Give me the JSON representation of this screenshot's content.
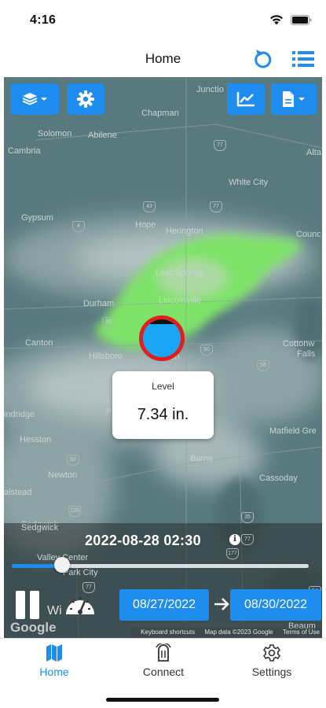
{
  "status_bar": {
    "time": "4:16"
  },
  "nav": {
    "title": "Home",
    "refresh_icon": "refresh-icon",
    "list_icon": "list-icon"
  },
  "map": {
    "places": {
      "junction": "Junctio",
      "chapman": "Chapman",
      "solomon": "Solomon",
      "abilene": "Abilene",
      "cambria": "Cambria",
      "alta": "Alta",
      "white_city": "White City",
      "gypsum": "Gypsum",
      "hope": "Hope",
      "herington": "Herington",
      "counc": "Counc",
      "lost_springs": "Lost Springs",
      "durham": "Durham",
      "lincolnville": "Lincolnville",
      "canton": "Canton",
      "hillsboro": "Hillsboro",
      "marion": "Marion",
      "cottonw": "Cottonw",
      "falls": "Falls",
      "indridge": "indridge",
      "hesston": "Hesston",
      "matfield_gre": "Matfield Gre",
      "burns": "Burns",
      "cassoday": "Cassoday",
      "newton": "Newton",
      "alstead": "alstead",
      "sedgwick": "Sedgwick",
      "valley_center": "Valley Center",
      "park_city": "Park City",
      "wichita": "Wi",
      "beaum": "Beaum"
    },
    "highways": [
      "77",
      "77",
      "43",
      "4",
      "56",
      "56",
      "77",
      "15",
      "50",
      "50",
      "135",
      "35",
      "77",
      "177",
      "77",
      "54"
    ],
    "buttons": {
      "layers_icon": "layers-icon",
      "settings_icon": "gear-icon",
      "chart_icon": "chart-icon",
      "file_icon": "file-icon"
    },
    "marker": {
      "label": "Level",
      "value": "7.34 in."
    },
    "google_logo": "Google",
    "attribution": {
      "shortcuts": "Keyboard shortcuts",
      "map_data": "Map data ©2023 Google",
      "terms": "Terms of Use"
    }
  },
  "playback": {
    "timestamp": "2022-08-28  02:30",
    "progress": 0.17,
    "start_date": "08/27/2022",
    "end_date": "08/30/2022",
    "pause_icon": "pause-icon",
    "speed_icon": "speedometer-icon",
    "info_icon": "info-icon",
    "arrow_icon": "arrow-right-icon"
  },
  "tabs": [
    {
      "label": "Home",
      "icon": "map-icon",
      "active": true
    },
    {
      "label": "Connect",
      "icon": "sensor-icon",
      "active": false
    },
    {
      "label": "Settings",
      "icon": "gear-icon",
      "active": false
    }
  ],
  "colors": {
    "accent": "#1f8cf0",
    "marker_ring": "#e31e1e",
    "marker_fill": "#1ba6f5",
    "radar": "#7fe36a"
  }
}
